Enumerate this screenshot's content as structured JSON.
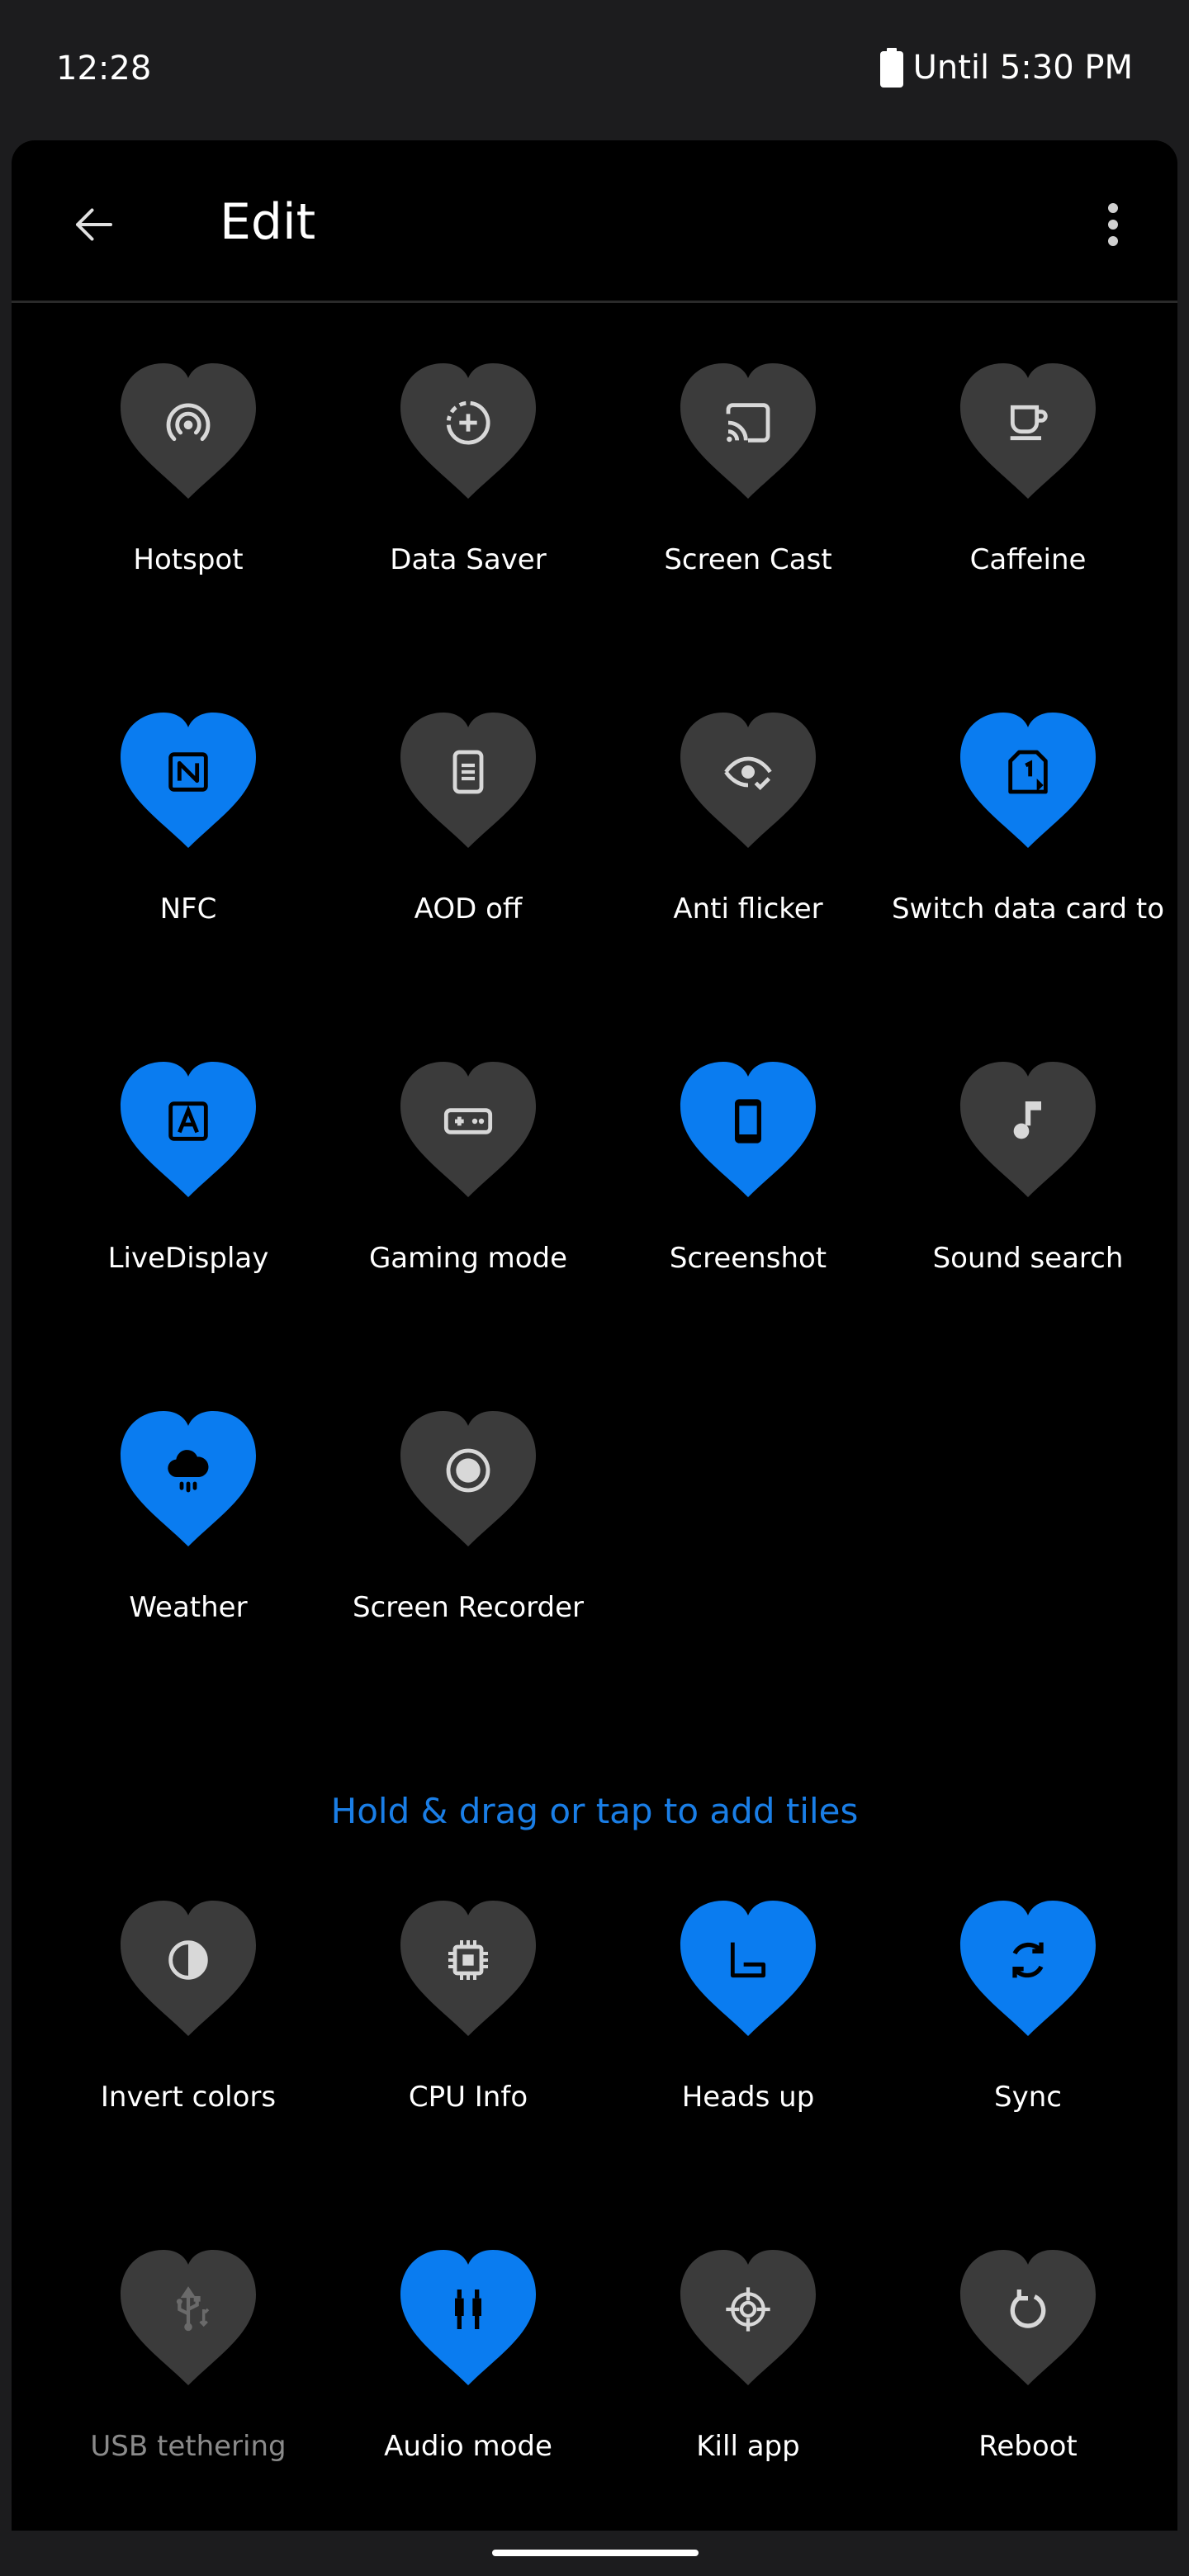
{
  "status_bar": {
    "time": "12:28",
    "battery_text": "Until 5:30 PM",
    "battery_icon": "battery-icon"
  },
  "app_bar": {
    "title": "Edit",
    "back_icon": "arrow-left-icon",
    "menu_icon": "more-vert-icon"
  },
  "colors": {
    "active": "#0a7cf0",
    "inactive": "#3b3b3b",
    "hint": "#1a7ee6"
  },
  "active_tiles": [
    {
      "label": "Hotspot",
      "icon": "hotspot-icon",
      "active": false
    },
    {
      "label": "Data Saver",
      "icon": "data-saver-icon",
      "active": false
    },
    {
      "label": "Screen Cast",
      "icon": "cast-icon",
      "active": false
    },
    {
      "label": "Caffeine",
      "icon": "coffee-cup-icon",
      "active": false
    },
    {
      "label": "NFC",
      "icon": "nfc-icon",
      "active": true
    },
    {
      "label": "AOD off",
      "icon": "aod-icon",
      "active": false
    },
    {
      "label": "Anti flicker",
      "icon": "eye-check-icon",
      "active": false
    },
    {
      "label": "Switch data card to",
      "icon": "sim-card-icon",
      "active": true
    },
    {
      "label": "LiveDisplay",
      "icon": "live-display-icon",
      "active": true
    },
    {
      "label": "Gaming mode",
      "icon": "gamepad-icon",
      "active": false
    },
    {
      "label": "Screenshot",
      "icon": "phone-icon",
      "active": true
    },
    {
      "label": "Sound search",
      "icon": "music-note-icon",
      "active": false
    },
    {
      "label": "Weather",
      "icon": "cloud-rain-icon",
      "active": true
    },
    {
      "label": "Screen Recorder",
      "icon": "record-icon",
      "active": false
    }
  ],
  "hint": "Hold & drag or tap to add tiles",
  "available_tiles": [
    {
      "label": "Invert colors",
      "icon": "invert-colors-icon",
      "active": false
    },
    {
      "label": "CPU Info",
      "icon": "cpu-icon",
      "active": false
    },
    {
      "label": "Heads up",
      "icon": "heads-up-icon",
      "active": true
    },
    {
      "label": "Sync",
      "icon": "sync-icon",
      "active": true
    },
    {
      "label": "USB tethering",
      "icon": "usb-icon",
      "active": false,
      "dim": true
    },
    {
      "label": "Audio mode",
      "icon": "audio-jack-icon",
      "active": true
    },
    {
      "label": "Kill app",
      "icon": "crosshair-icon",
      "active": false
    },
    {
      "label": "Reboot",
      "icon": "reboot-icon",
      "active": false
    }
  ]
}
